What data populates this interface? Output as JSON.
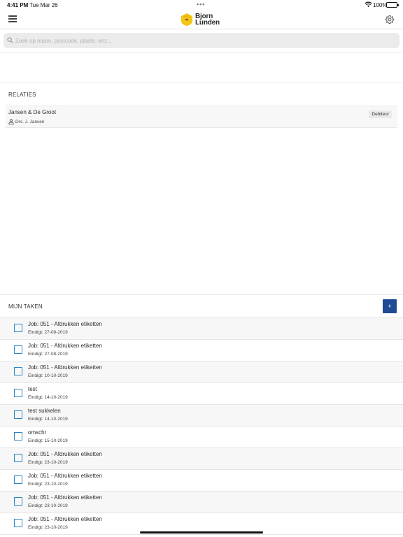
{
  "status_bar": {
    "time": "4:41 PM",
    "date": "Tue Mar 26",
    "battery": "100%",
    "multitask_dots": "•••"
  },
  "header": {
    "logo_line1": "Bjorn",
    "logo_line2": "Lunden",
    "menu_icon": "hamburger-icon",
    "settings_icon": "gear-icon",
    "brand_color": "#f5c518"
  },
  "search": {
    "placeholder": "Zoek op naam, postcode, plaats, enz...",
    "value": ""
  },
  "relaties": {
    "title": "RELATIES",
    "items": [
      {
        "name": "Jansen & De Groot",
        "contact": "Drs. J. Jansen",
        "badge": "Debiteur"
      }
    ]
  },
  "taken": {
    "title": "MIJN TAKEN",
    "add_label": "+",
    "accent_color": "#1f4a94",
    "items": [
      {
        "title": "Job: 051 - Afdrukken etiketten",
        "due": "Eindigt: 27-08-2019"
      },
      {
        "title": "Job: 051 - Afdrukken etiketten",
        "due": "Eindigt: 27-08-2019"
      },
      {
        "title": "Job: 051 - Afdrukken etiketten",
        "due": "Eindigt: 10-10-2019"
      },
      {
        "title": "test",
        "due": "Eindigt: 14-10-2019"
      },
      {
        "title": "test sukkelen",
        "due": "Eindigt: 14-10-2019"
      },
      {
        "title": "omschr",
        "due": "Eindigt: 15-10-2019"
      },
      {
        "title": "Job: 051 - Afdrukken etiketten",
        "due": "Eindigt: 23-10-2019"
      },
      {
        "title": "Job: 051 - Afdrukken etiketten",
        "due": "Eindigt: 23-10-2019"
      },
      {
        "title": "Job: 051 - Afdrukken etiketten",
        "due": "Eindigt: 23-10-2019"
      },
      {
        "title": "Job: 051 - Afdrukken etiketten",
        "due": "Eindigt: 23-10-2019"
      }
    ]
  }
}
